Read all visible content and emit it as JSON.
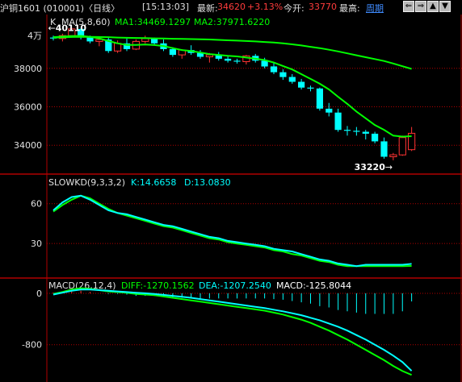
{
  "topbar": {
    "title": "沪铜1601 (010001)〈日线〉",
    "time": "[15:13:03]",
    "price_label": "最新:",
    "price": "34620",
    "change": "+3.13%",
    "open_label": "今开:",
    "open": "33770",
    "high_label": "最高:",
    "period_link": "周期",
    "nav_buttons": [
      "⇐",
      "⇒",
      "▲",
      "▼"
    ]
  },
  "colors": {
    "up": "#ff3333",
    "down": "#00ffff",
    "ma1": "#ff33ff",
    "ma2": "#00ff00",
    "k_line": "#00ffff",
    "d_line": "#00ff00",
    "diff": "#00ffff",
    "dea": "#00ff00",
    "grid": "#b00000",
    "axis_text": "#e0e0e0"
  },
  "chart_data": [
    {
      "type": "candlestick",
      "panel_label": "K",
      "indicator": "MA(5,8,60)",
      "legend": [
        {
          "text": "MA1:34469.1297",
          "color": "#00ff00"
        },
        {
          "text": "MA2:37971.6220",
          "color": "#00ff00"
        }
      ],
      "y_unit_label": "4万",
      "y_ticks": [
        38000,
        36000,
        34000
      ],
      "ylim": [
        32500,
        40800
      ],
      "annotations": {
        "high": "40110",
        "low": "33220"
      },
      "candles": [
        [
          39600,
          39700,
          39450,
          39550
        ],
        [
          39550,
          39800,
          39400,
          39700
        ],
        [
          39700,
          40110,
          39600,
          40050
        ],
        [
          40050,
          40100,
          39500,
          39600
        ],
        [
          39600,
          39700,
          39300,
          39400
        ],
        [
          39400,
          39650,
          39150,
          39500
        ],
        [
          39500,
          39600,
          38800,
          38900
        ],
        [
          38900,
          39450,
          38800,
          39300
        ],
        [
          39300,
          39550,
          38900,
          39000
        ],
        [
          39000,
          39500,
          38950,
          39400
        ],
        [
          39400,
          39700,
          39300,
          39550
        ],
        [
          39550,
          39600,
          39200,
          39300
        ],
        [
          39300,
          39500,
          38900,
          39000
        ],
        [
          39000,
          39100,
          38600,
          38700
        ],
        [
          38700,
          39000,
          38500,
          38950
        ],
        [
          38950,
          39200,
          38700,
          38800
        ],
        [
          38800,
          38950,
          38500,
          38600
        ],
        [
          38600,
          38800,
          38300,
          38700
        ],
        [
          38700,
          38850,
          38400,
          38500
        ],
        [
          38500,
          38650,
          38300,
          38400
        ],
        [
          38400,
          38500,
          38250,
          38350
        ],
        [
          38350,
          38700,
          38200,
          38650
        ],
        [
          38650,
          38750,
          38300,
          38400
        ],
        [
          38400,
          38550,
          38000,
          38100
        ],
        [
          38100,
          38300,
          37700,
          37800
        ],
        [
          37800,
          37950,
          37400,
          37550
        ],
        [
          37550,
          37700,
          37200,
          37300
        ],
        [
          37300,
          37450,
          36900,
          37000
        ],
        [
          37000,
          37100,
          36800,
          36950
        ],
        [
          36950,
          37000,
          35800,
          35900
        ],
        [
          35900,
          36200,
          35500,
          35700
        ],
        [
          35700,
          35900,
          34700,
          34800
        ],
        [
          34800,
          35000,
          34500,
          34750
        ],
        [
          34750,
          34950,
          34500,
          34700
        ],
        [
          34700,
          34800,
          34300,
          34600
        ],
        [
          34600,
          34700,
          34100,
          34200
        ],
        [
          34200,
          34400,
          33300,
          33400
        ],
        [
          33400,
          33600,
          33220,
          33500
        ],
        [
          33500,
          34500,
          33450,
          34400
        ],
        [
          33770,
          34950,
          33700,
          34620
        ]
      ],
      "ma1": [
        39620,
        39650,
        39680,
        39690,
        39640,
        39560,
        39420,
        39300,
        39220,
        39220,
        39240,
        39210,
        39160,
        39050,
        38950,
        38900,
        38820,
        38740,
        38700,
        38650,
        38620,
        38560,
        38500,
        38430,
        38300,
        38120,
        37940,
        37700,
        37450,
        37200,
        36900,
        36520,
        36150,
        35750,
        35400,
        35050,
        34800,
        34500,
        34450,
        34469
      ],
      "ma2": [
        39600,
        39610,
        39630,
        39640,
        39640,
        39630,
        39620,
        39600,
        39590,
        39580,
        39570,
        39560,
        39550,
        39540,
        39530,
        39520,
        39510,
        39500,
        39480,
        39460,
        39440,
        39420,
        39400,
        39370,
        39340,
        39300,
        39250,
        39190,
        39120,
        39050,
        38970,
        38880,
        38780,
        38680,
        38580,
        38480,
        38380,
        38250,
        38110,
        37971
      ]
    },
    {
      "type": "line",
      "title": "SLOWKD(9,3,3,2)",
      "legend": [
        {
          "text": "K:14.6658",
          "color": "#00ffff"
        },
        {
          "text": "D:13.0830",
          "color": "#00ffff"
        }
      ],
      "y_ticks": [
        60,
        30
      ],
      "ylim": [
        4,
        75
      ],
      "series": [
        {
          "name": "K",
          "values": [
            55,
            61,
            65,
            66,
            63,
            59,
            55,
            53,
            52,
            50,
            48,
            46,
            44,
            43,
            41,
            39,
            37,
            35,
            34,
            32,
            31,
            30,
            29,
            28,
            26,
            25,
            24,
            22,
            20,
            18,
            17,
            15,
            14,
            13,
            14,
            14,
            14,
            14,
            14,
            14.6658
          ]
        },
        {
          "name": "D",
          "values": [
            54,
            59,
            63,
            66,
            64,
            60,
            56,
            53,
            51,
            49,
            47,
            45,
            43,
            42,
            40,
            38,
            36,
            34,
            33,
            31,
            30,
            29,
            28,
            27,
            25,
            24,
            22,
            21,
            19,
            17,
            16,
            14,
            13,
            13,
            13,
            13,
            13,
            13,
            13,
            13.083
          ]
        }
      ]
    },
    {
      "type": "line",
      "title": "MACD(26,12,4)",
      "legend": [
        {
          "text": "DIFF:-1270.1562",
          "color": "#00ff00"
        },
        {
          "text": "DEA:-1207.2540",
          "color": "#00ffff"
        },
        {
          "text": "MACD:-125.8044",
          "color": "#ffffff"
        }
      ],
      "y_ticks": [
        0,
        -800
      ],
      "ylim": [
        -1380,
        200
      ],
      "series": [
        {
          "name": "DIFF",
          "values": [
            -10,
            20,
            60,
            80,
            70,
            50,
            30,
            20,
            10,
            -10,
            -20,
            -30,
            -50,
            -70,
            -90,
            -110,
            -130,
            -150,
            -170,
            -190,
            -210,
            -230,
            -250,
            -270,
            -300,
            -330,
            -370,
            -410,
            -460,
            -520,
            -580,
            -650,
            -720,
            -800,
            -880,
            -960,
            -1040,
            -1130,
            -1210,
            -1270
          ]
        },
        {
          "name": "DEA",
          "values": [
            -20,
            10,
            40,
            60,
            60,
            50,
            40,
            30,
            20,
            10,
            0,
            -10,
            -25,
            -40,
            -55,
            -70,
            -90,
            -110,
            -130,
            -150,
            -170,
            -190,
            -210,
            -230,
            -255,
            -280,
            -310,
            -340,
            -380,
            -420,
            -470,
            -520,
            -580,
            -650,
            -720,
            -800,
            -880,
            -970,
            -1070,
            -1207
          ]
        },
        {
          "name": "MACD",
          "values": [
            10,
            20,
            40,
            40,
            20,
            0,
            -10,
            -10,
            -20,
            -40,
            -40,
            -40,
            -50,
            -60,
            -70,
            -80,
            -80,
            -80,
            -80,
            -80,
            -80,
            -80,
            -80,
            -80,
            -90,
            -100,
            -120,
            -140,
            -160,
            -200,
            -220,
            -260,
            -280,
            -300,
            -320,
            -320,
            -320,
            -320,
            -280,
            -126
          ]
        }
      ]
    }
  ]
}
